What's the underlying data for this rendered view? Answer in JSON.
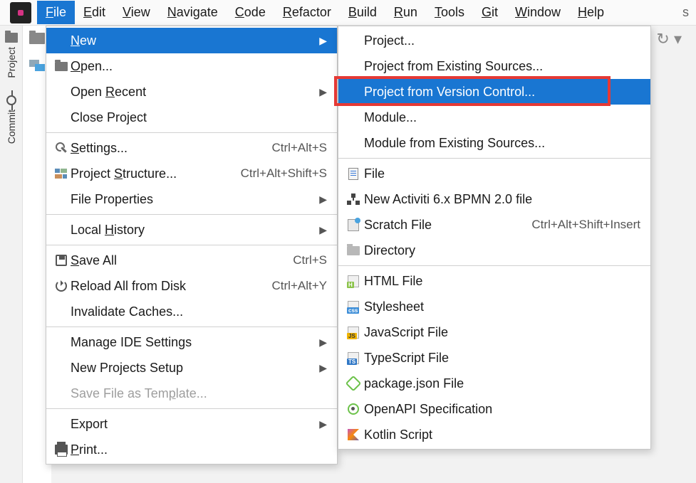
{
  "menubar": {
    "items": [
      {
        "label": "File",
        "u": 0
      },
      {
        "label": "Edit",
        "u": 0
      },
      {
        "label": "View",
        "u": 0
      },
      {
        "label": "Navigate",
        "u": 0
      },
      {
        "label": "Code",
        "u": 0
      },
      {
        "label": "Refactor",
        "u": 0
      },
      {
        "label": "Build",
        "u": 0
      },
      {
        "label": "Run",
        "u": 0
      },
      {
        "label": "Tools",
        "u": 0
      },
      {
        "label": "Git",
        "u": 0
      },
      {
        "label": "Window",
        "u": 0
      },
      {
        "label": "Help",
        "u": 0
      }
    ],
    "right_partial": "s"
  },
  "left_strip": {
    "project_label": "Project",
    "commit_label": "Commit"
  },
  "file_menu": {
    "items": [
      {
        "label": "New",
        "u": 0,
        "submenu": true,
        "highlight": true
      },
      {
        "label": "Open...",
        "u": 0,
        "icon": "folder"
      },
      {
        "label": "Open Recent",
        "u": 5,
        "submenu": true
      },
      {
        "label": "Close Project"
      },
      {
        "sep": true
      },
      {
        "label": "Settings...",
        "u": 0,
        "icon": "wrench",
        "shortcut": "Ctrl+Alt+S"
      },
      {
        "label": "Project Structure...",
        "u": 8,
        "icon": "struct",
        "shortcut": "Ctrl+Alt+Shift+S"
      },
      {
        "label": "File Properties",
        "submenu": true
      },
      {
        "sep": true
      },
      {
        "label": "Local History",
        "u": 6,
        "submenu": true
      },
      {
        "sep": true
      },
      {
        "label": "Save All",
        "u": 0,
        "icon": "save",
        "shortcut": "Ctrl+S"
      },
      {
        "label": "Reload All from Disk",
        "icon": "reload",
        "shortcut": "Ctrl+Alt+Y"
      },
      {
        "label": "Invalidate Caches..."
      },
      {
        "sep": true
      },
      {
        "label": "Manage IDE Settings",
        "submenu": true
      },
      {
        "label": "New Projects Setup",
        "submenu": true
      },
      {
        "label": "Save File as Template...",
        "u": 16,
        "disabled": true
      },
      {
        "sep": true
      },
      {
        "label": "Export",
        "submenu": true
      },
      {
        "label": "Print...",
        "u": 0,
        "icon": "print"
      }
    ]
  },
  "new_submenu": {
    "items": [
      {
        "label": "Project..."
      },
      {
        "label": "Project from Existing Sources..."
      },
      {
        "label": "Project from Version Control...",
        "highlight": true,
        "redbox": true
      },
      {
        "label": "Module..."
      },
      {
        "label": "Module from Existing Sources..."
      },
      {
        "sep": true
      },
      {
        "label": "File",
        "icon": "file"
      },
      {
        "label": "New Activiti 6.x BPMN 2.0 file",
        "icon": "tree"
      },
      {
        "label": "Scratch File",
        "icon": "scratch",
        "shortcut": "Ctrl+Alt+Shift+Insert"
      },
      {
        "label": "Directory",
        "icon": "dir"
      },
      {
        "sep": true
      },
      {
        "label": "HTML File",
        "icon": "html"
      },
      {
        "label": "Stylesheet",
        "icon": "css"
      },
      {
        "label": "JavaScript File",
        "icon": "js"
      },
      {
        "label": "TypeScript File",
        "icon": "ts"
      },
      {
        "label": "package.json File",
        "icon": "node"
      },
      {
        "label": "OpenAPI Specification",
        "icon": "api"
      },
      {
        "label": "Kotlin Script",
        "icon": "kotlin"
      }
    ]
  }
}
